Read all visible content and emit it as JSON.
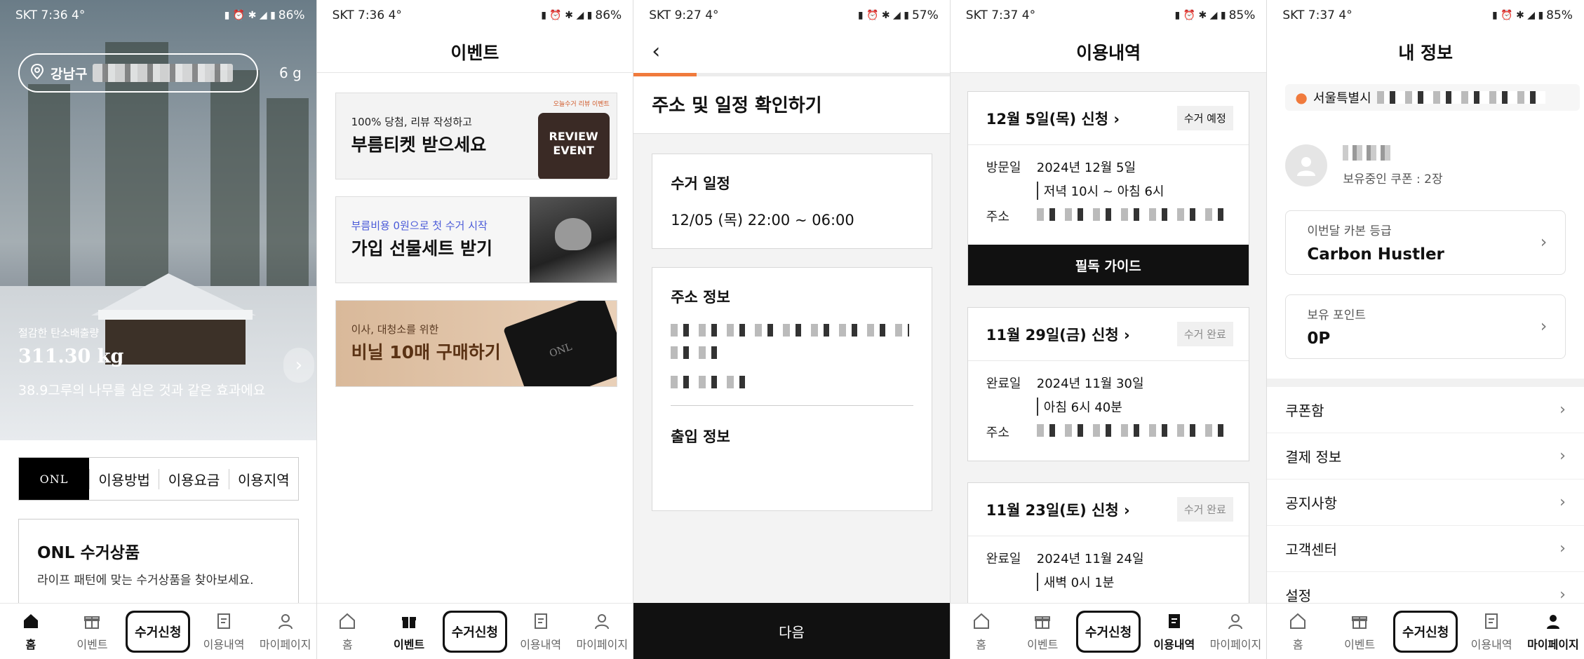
{
  "screens": {
    "home": {
      "status": {
        "carrier": "SKT 7:36",
        "temp": "4°",
        "battery": "86%"
      },
      "location": "강남구",
      "hero_g": "6 g",
      "hero": {
        "label": "절감한 탄소배출량",
        "value": "311.30 kg",
        "caption": "38.9그루의 나무를 심은 것과 같은 효과에요"
      },
      "logo": "ONL",
      "tabs": [
        "이용방법",
        "이용요금",
        "이용지역"
      ],
      "card": {
        "title": "ONL 수거상품",
        "subtitle": "라이프 패턴에 맞는 수거상품을 찾아보세요."
      }
    },
    "events": {
      "status": {
        "carrier": "SKT 7:36",
        "temp": "4°",
        "battery": "86%"
      },
      "title": "이벤트",
      "banners": [
        {
          "sub": "100% 당첨, 리뷰 작성하고",
          "main": "부름티켓 받으세요",
          "badge": "REVIEW EVENT",
          "badge_top": "오늘수거 리뷰 이벤트"
        },
        {
          "sub": "부름비용 0원으로 첫 수거 시작",
          "main": "가입 선물세트 받기"
        },
        {
          "sub": "이사, 대청소를 위한",
          "main": "비닐 10매 구매하기",
          "bag_logo": "ONL"
        }
      ]
    },
    "confirm": {
      "status": {
        "carrier": "SKT 9:27",
        "temp": "4°",
        "battery": "57%"
      },
      "title": "주소 및 일정 확인하기",
      "schedule_label": "수거 일정",
      "schedule_value": "12/05 (목) 22:00 ~ 06:00",
      "address_label": "주소 정보",
      "entry_label": "출입 정보",
      "next": "다음"
    },
    "history": {
      "status": {
        "carrier": "SKT 7:37",
        "temp": "4°",
        "battery": "85%"
      },
      "title": "이용내역",
      "records": [
        {
          "date": "12월 5일(목) 신청 ›",
          "tag": "수거 예정",
          "k1": "방문일",
          "v1": "2024년 12월 5일",
          "v1b": "저녁 10시 ~ 아침 6시",
          "k2": "주소",
          "guide": "필독 가이드"
        },
        {
          "date": "11월 29일(금) 신청 ›",
          "tag": "수거 완료",
          "k1": "완료일",
          "v1": "2024년 11월 30일",
          "v1b": "아침 6시 40분",
          "k2": "주소"
        },
        {
          "date": "11월 23일(토) 신청 ›",
          "tag": "수거 완료",
          "k1": "완료일",
          "v1": "2024년 11월 24일",
          "v1b": "새벽 0시 1분"
        }
      ]
    },
    "mypage": {
      "status": {
        "carrier": "SKT 7:37",
        "temp": "4°",
        "battery": "85%"
      },
      "title": "내 정보",
      "address": "서울특별시",
      "coupon": "보유중인 쿠폰 : 2장",
      "grade_label": "이번달 카본 등급",
      "grade_value": "Carbon Hustler",
      "points_label": "보유 포인트",
      "points_value": "0P",
      "menu": [
        "쿠폰함",
        "결제 정보",
        "공지사항",
        "고객센터",
        "설정"
      ]
    }
  },
  "nav": {
    "home": "홈",
    "event": "이벤트",
    "pickup": "수거신청",
    "history": "이용내역",
    "mypage": "마이페이지"
  },
  "colors": {
    "accent": "#f07a3c",
    "dark": "#111111"
  }
}
